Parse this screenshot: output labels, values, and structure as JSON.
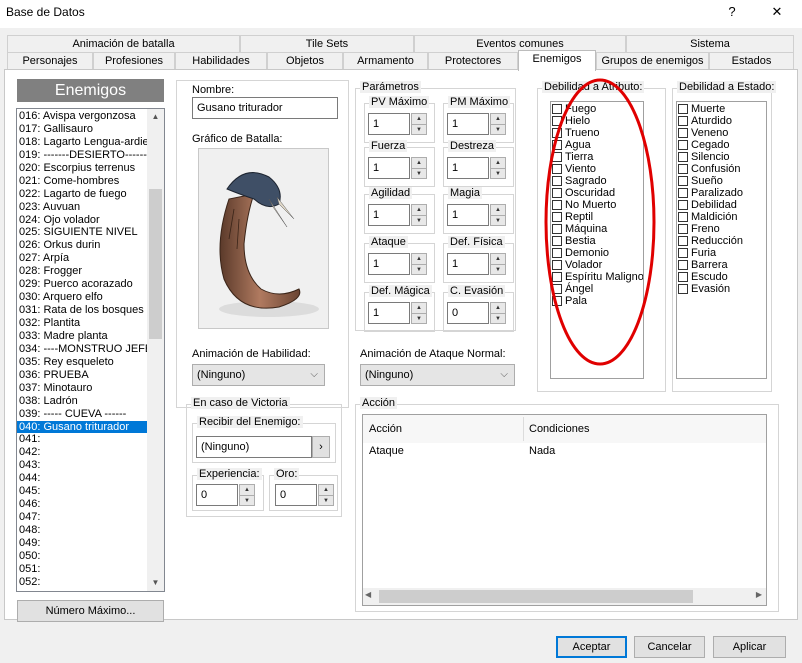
{
  "window": {
    "title": "Base de Datos",
    "help_glyph": "?",
    "close_glyph": "✕"
  },
  "tabs_row1": [
    "Animación de batalla",
    "Tile Sets",
    "Eventos comunes",
    "Sistema"
  ],
  "tabs_row2": [
    "Personajes",
    "Profesiones",
    "Habilidades",
    "Objetos",
    "Armamento",
    "Protectores",
    "Enemigos",
    "Grupos de enemigos",
    "Estados"
  ],
  "enemies_header": "Enemigos",
  "enemy_list": [
    "016: Avispa vergonzosa",
    "017: Gallisauro",
    "018: Lagarto Lengua-ardiente",
    "019: -------DESIERTO-------",
    "020: Escorpius terrenus",
    "021: Come-hombres",
    "022: Lagarto de fuego",
    "023: Auvuan",
    "024: Ojo volador",
    "025: SIGUIENTE NIVEL",
    "026: Orkus durin",
    "027: Arpía",
    "028: Frogger",
    "029: Puerco acorazado",
    "030: Arquero elfo",
    "031: Rata de los bosques",
    "032: Plantita",
    "033: Madre planta",
    "034: ----MONSTRUO JEFE----",
    "035: Rey esqueleto",
    "036: PRUEBA",
    "037: Minotauro",
    "038: Ladrón",
    "039: ----- CUEVA ------",
    "040: Gusano triturador",
    "041:",
    "042:",
    "043:",
    "044:",
    "045:",
    "046:",
    "047:",
    "048:",
    "049:",
    "050:",
    "051:",
    "052:"
  ],
  "selected_enemy": "040: Gusano triturador",
  "max_button": "Número Máximo...",
  "name": {
    "label": "Nombre:",
    "value": "Gusano triturador"
  },
  "battle_graphic_label": "Gráfico de Batalla:",
  "params": {
    "label": "Parámetros",
    "items": [
      {
        "label": "PV Máximo",
        "value": "1"
      },
      {
        "label": "PM Máximo",
        "value": "1"
      },
      {
        "label": "Fuerza",
        "value": "1"
      },
      {
        "label": "Destreza",
        "value": "1"
      },
      {
        "label": "Agilidad",
        "value": "1"
      },
      {
        "label": "Magia",
        "value": "1"
      },
      {
        "label": "Ataque",
        "value": "1"
      },
      {
        "label": "Def. Física",
        "value": "1"
      },
      {
        "label": "Def. Mágica",
        "value": "1"
      },
      {
        "label": "C. Evasión",
        "value": "0"
      }
    ]
  },
  "attr_weakness": {
    "label": "Debilidad a Atributo:",
    "items": [
      "Fuego",
      "Hielo",
      "Trueno",
      "Agua",
      "Tierra",
      "Viento",
      "Sagrado",
      "Oscuridad",
      "No Muerto",
      "Reptil",
      "Máquina",
      "Bestia",
      "Demonio",
      "Volador",
      "Espíritu Maligno",
      "Ángel",
      "Pala"
    ]
  },
  "state_weakness": {
    "label": "Debilidad a Estado:",
    "items": [
      "Muerte",
      "Aturdido",
      "Veneno",
      "Cegado",
      "Silencio",
      "Confusión",
      "Sueño",
      "Paralizado",
      "Debilidad",
      "Maldición",
      "Freno",
      "Reducción",
      "Furia",
      "Barrera",
      "Escudo",
      "Evasión"
    ]
  },
  "skill_anim": {
    "label": "Animación de Habilidad:",
    "value": "(Ninguno)"
  },
  "attack_anim": {
    "label": "Animación de Ataque Normal:",
    "value": "(Ninguno)"
  },
  "victory": {
    "label": "En caso de Victoria",
    "receive_label": "Recibir del Enemigo:",
    "receive_value": "(Ninguno)",
    "receive_button": "›",
    "exp_label": "Experiencia:",
    "exp_value": "0",
    "gold_label": "Oro:",
    "gold_value": "0"
  },
  "action": {
    "label": "Acción",
    "col_action": "Acción",
    "col_conditions": "Condiciones",
    "rows": [
      {
        "action": "Ataque",
        "conditions": "Nada"
      }
    ]
  },
  "footer": {
    "accept": "Aceptar",
    "cancel": "Cancelar",
    "apply": "Aplicar"
  },
  "annotation_color": "#e00000",
  "accent_color": "#0078d7"
}
